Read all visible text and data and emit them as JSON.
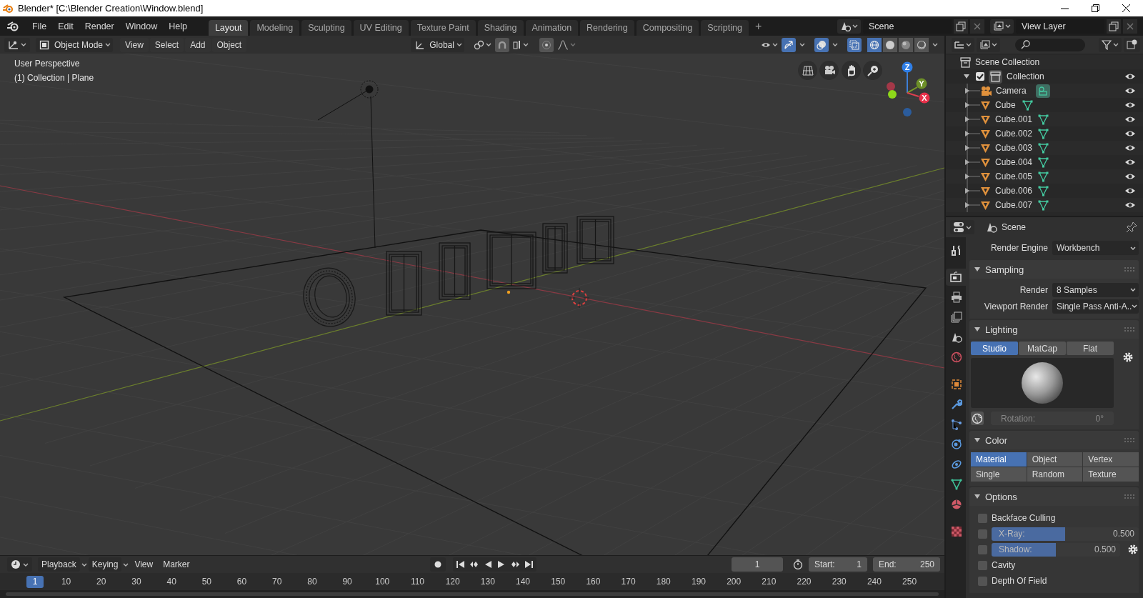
{
  "window": {
    "title": "Blender* [C:\\Blender Creation\\Window.blend]"
  },
  "menu": [
    "File",
    "Edit",
    "Render",
    "Window",
    "Help"
  ],
  "workspaces": [
    {
      "label": "Layout",
      "selected": true
    },
    {
      "label": "Modeling",
      "selected": false
    },
    {
      "label": "Sculpting",
      "selected": false
    },
    {
      "label": "UV Editing",
      "selected": false
    },
    {
      "label": "Texture Paint",
      "selected": false
    },
    {
      "label": "Shading",
      "selected": false
    },
    {
      "label": "Animation",
      "selected": false
    },
    {
      "label": "Rendering",
      "selected": false
    },
    {
      "label": "Compositing",
      "selected": false
    },
    {
      "label": "Scripting",
      "selected": false
    }
  ],
  "add_workspace": "+",
  "scene": "Scene",
  "view_layer": "View Layer",
  "viewport": {
    "mode": "Object Mode",
    "menus": [
      "View",
      "Select",
      "Add",
      "Object"
    ],
    "orientation": "Global",
    "gizmos": true,
    "overlays": true,
    "xray": true,
    "shading": [
      {
        "kind": "wireframe",
        "selected": true
      },
      {
        "kind": "solid",
        "selected": false
      },
      {
        "kind": "material",
        "selected": false
      },
      {
        "kind": "rendered",
        "selected": false
      }
    ],
    "view_name": "User Perspective",
    "context": "(1) Collection | Plane",
    "axes": [
      "Z",
      "Y",
      "X"
    ]
  },
  "outliner": {
    "root": "Scene Collection",
    "collections": [
      {
        "label": "Collection",
        "checked": true,
        "expanded": true,
        "children": [
          {
            "label": "Camera",
            "kind": "camera"
          },
          {
            "label": "Cube",
            "kind": "mesh"
          },
          {
            "label": "Cube.001",
            "kind": "mesh"
          },
          {
            "label": "Cube.002",
            "kind": "mesh"
          },
          {
            "label": "Cube.003",
            "kind": "mesh"
          },
          {
            "label": "Cube.004",
            "kind": "mesh"
          },
          {
            "label": "Cube.005",
            "kind": "mesh"
          },
          {
            "label": "Cube.006",
            "kind": "mesh"
          },
          {
            "label": "Cube.007",
            "kind": "mesh"
          }
        ]
      }
    ]
  },
  "properties": {
    "context": "Scene",
    "tabs": [
      {
        "kind": "tool",
        "selected": false
      },
      {
        "kind": "render",
        "selected": true
      },
      {
        "kind": "output",
        "selected": false
      },
      {
        "kind": "view_layer",
        "selected": false
      },
      {
        "kind": "scene",
        "selected": false
      },
      {
        "kind": "world",
        "selected": false
      },
      {
        "kind": "object",
        "selected": false
      },
      {
        "kind": "modifier",
        "selected": false
      },
      {
        "kind": "particles",
        "selected": false
      },
      {
        "kind": "physics",
        "selected": false
      },
      {
        "kind": "constraints",
        "selected": false
      },
      {
        "kind": "data",
        "selected": false
      },
      {
        "kind": "material",
        "selected": false
      },
      {
        "kind": "texture",
        "selected": false
      }
    ],
    "render_engine": {
      "label": "Render Engine",
      "value": "Workbench"
    },
    "panels": [
      {
        "kind": "fields",
        "title": "Sampling",
        "expanded": true,
        "rows": [
          {
            "label": "Render",
            "value": "8 Samples"
          },
          {
            "label": "Viewport Render",
            "value": "Single Pass Anti-A.."
          }
        ]
      },
      {
        "kind": "lighting",
        "title": "Lighting",
        "expanded": true,
        "options": [
          {
            "label": "Studio",
            "selected": true
          },
          {
            "label": "MatCap",
            "selected": false
          },
          {
            "label": "Flat",
            "selected": false
          }
        ],
        "rotation": {
          "label": "Rotation:",
          "value": "0°"
        }
      },
      {
        "kind": "grid",
        "title": "Color",
        "expanded": true,
        "options": [
          {
            "label": "Material",
            "selected": true
          },
          {
            "label": "Object",
            "selected": false
          },
          {
            "label": "Vertex",
            "selected": false
          },
          {
            "label": "Single",
            "selected": false
          },
          {
            "label": "Random",
            "selected": false
          },
          {
            "label": "Texture",
            "selected": false
          }
        ]
      },
      {
        "kind": "options",
        "title": "Options",
        "expanded": true,
        "rows": [
          {
            "kind": "checkbox",
            "label": "Backface Culling",
            "checked": false
          },
          {
            "kind": "slider",
            "label": "X-Ray:",
            "checked": false,
            "level": 0.5,
            "value": "0.500",
            "settings": false
          },
          {
            "kind": "slider",
            "label": "Shadow:",
            "checked": false,
            "level": 0.5,
            "value": "0.500",
            "settings": true
          },
          {
            "kind": "checkbox",
            "label": "Cavity",
            "checked": false
          },
          {
            "kind": "checkbox",
            "label": "Depth Of Field",
            "checked": false
          }
        ]
      }
    ]
  },
  "timeline": {
    "menus": [
      "Playback",
      "Keying",
      "View",
      "Marker"
    ],
    "current_frame": "1",
    "start": {
      "label": "Start:",
      "value": "1"
    },
    "end": {
      "label": "End:",
      "value": "250"
    },
    "ruler_current": "1",
    "ruler_ticks": [
      "10",
      "20",
      "30",
      "40",
      "50",
      "60",
      "70",
      "80",
      "90",
      "100",
      "110",
      "120",
      "130",
      "140",
      "150",
      "160",
      "170",
      "180",
      "190",
      "200",
      "210",
      "220",
      "230",
      "240",
      "250"
    ]
  }
}
